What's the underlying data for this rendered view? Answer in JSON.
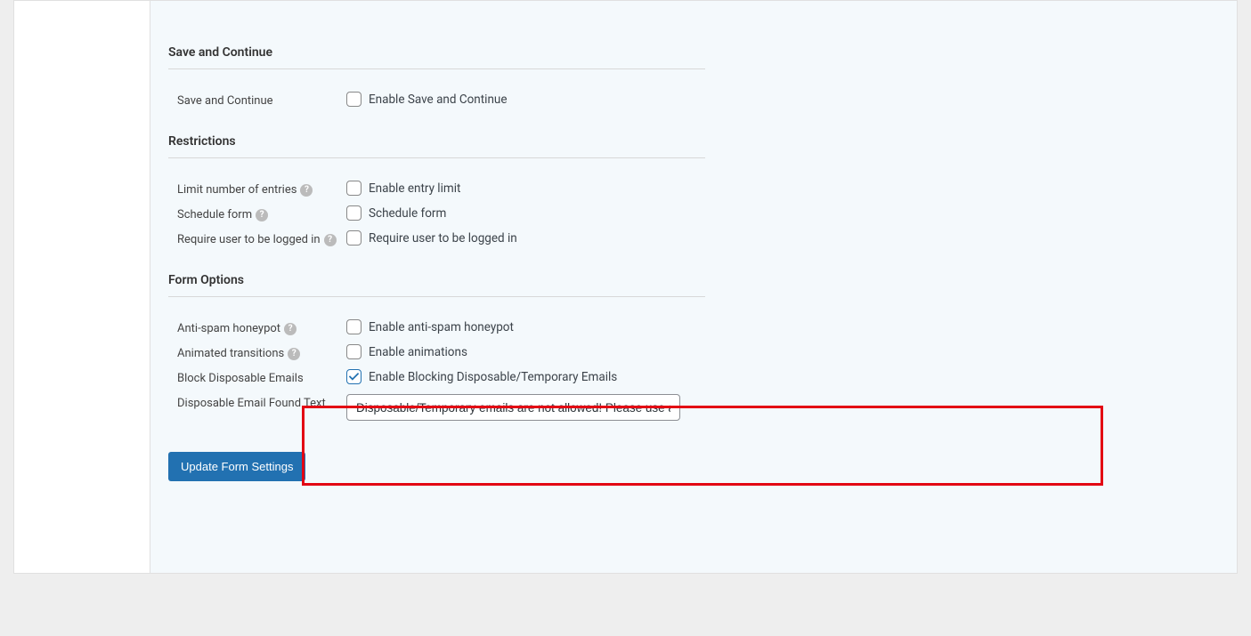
{
  "sections": {
    "save_continue": {
      "title": "Save and Continue",
      "row": {
        "label": "Save and Continue",
        "checkbox_label": "Enable Save and Continue"
      }
    },
    "restrictions": {
      "title": "Restrictions",
      "limit_entries": {
        "label": "Limit number of entries",
        "checkbox_label": "Enable entry limit"
      },
      "schedule_form": {
        "label": "Schedule form",
        "checkbox_label": "Schedule form"
      },
      "require_login": {
        "label": "Require user to be logged in",
        "checkbox_label": "Require user to be logged in"
      }
    },
    "form_options": {
      "title": "Form Options",
      "anti_spam": {
        "label": "Anti-spam honeypot",
        "checkbox_label": "Enable anti-spam honeypot"
      },
      "animated": {
        "label": "Animated transitions",
        "checkbox_label": "Enable animations"
      },
      "block_disposable": {
        "label": "Block Disposable Emails",
        "checkbox_label": "Enable Blocking Disposable/Temporary Emails"
      },
      "disposable_text": {
        "label": "Disposable Email Found Text",
        "value": "Disposable/Temporary emails are not allowed! Please use a no"
      }
    }
  },
  "button": {
    "update": "Update Form Settings"
  },
  "help_tooltip": "?"
}
